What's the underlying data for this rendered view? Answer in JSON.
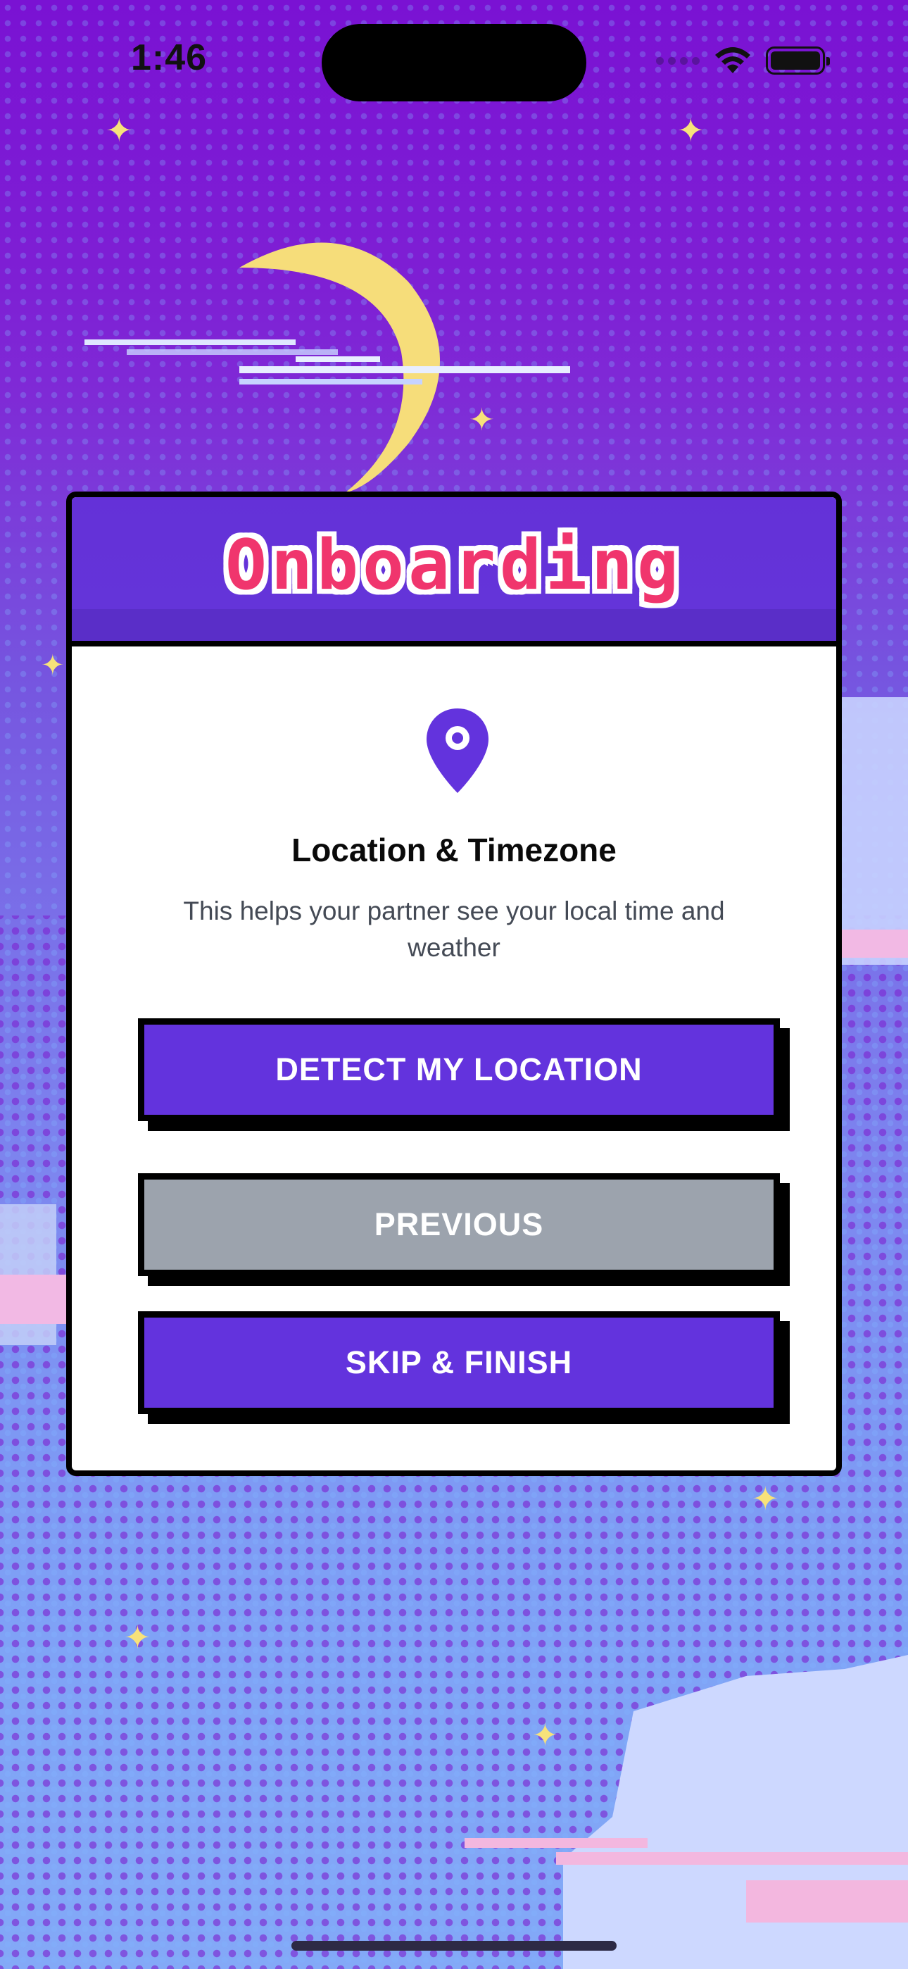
{
  "status_bar": {
    "time": "1:46"
  },
  "onboarding": {
    "title": "Onboarding",
    "step": {
      "icon": "location-pin-icon",
      "title": "Location & Timezone",
      "description": "This helps your partner see your local time and weather"
    },
    "buttons": {
      "detect": "DETECT MY LOCATION",
      "previous": "PREVIOUS",
      "skip": "SKIP & FINISH"
    }
  },
  "colors": {
    "accent": "#6333dd",
    "title_pink": "#f0356d",
    "secondary_button": "#9ca3ad",
    "background_top": "#7a12d3",
    "background_bottom": "#83a9f7"
  }
}
